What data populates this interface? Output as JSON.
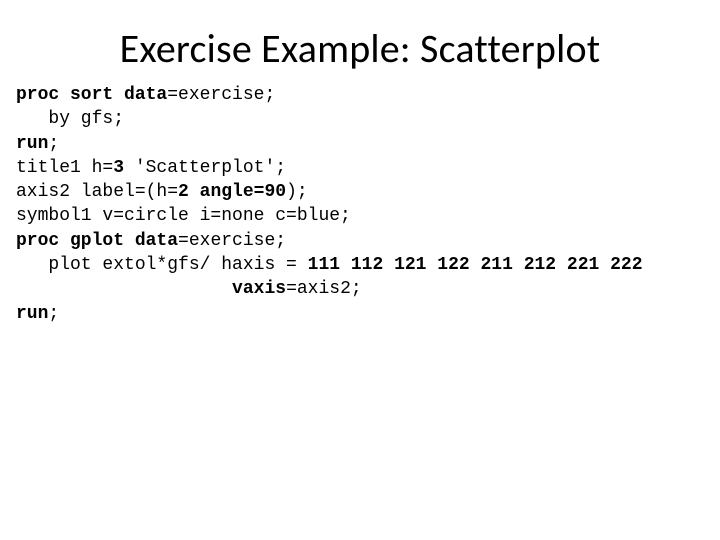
{
  "title": "Exercise Example: Scatterplot",
  "code": {
    "l1a": "proc sort",
    "l1b": " data",
    "l1c": "=exercise;",
    "l2": "   by gfs;",
    "l3": "run",
    "l3b": ";",
    "l4a": "title1 h=",
    "l4b": "3",
    "l4c": " 'Scatterplot';",
    "l5a": "axis2 label=(h=",
    "l5b": "2",
    "l5c": " angle=",
    "l5d": "90",
    "l5e": ");",
    "l6": "symbol1 v=circle i=none c=blue;",
    "l7a": "proc gplot",
    "l7b": " data",
    "l7c": "=exercise;",
    "l8a": "   plot extol*gfs/ haxis = ",
    "l8b": "111 112 121 122 211 212 221 222",
    "l9a": "                    ",
    "l9b": "vaxis",
    "l9c": "=axis2;",
    "l10": "run",
    "l10b": ";"
  }
}
